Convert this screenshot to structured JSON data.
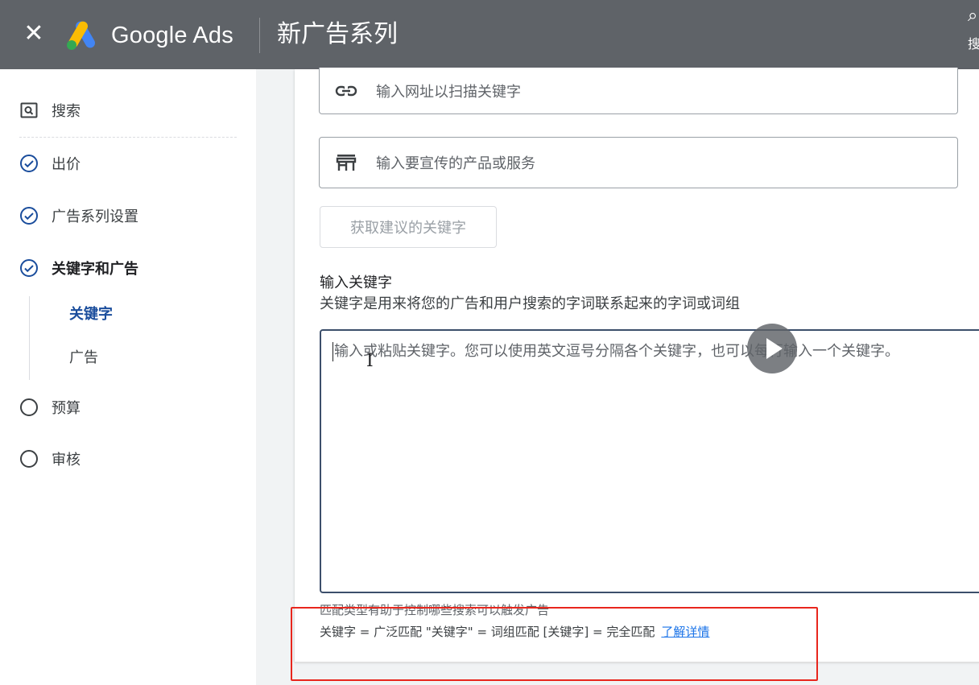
{
  "header": {
    "close_icon": "close-icon",
    "brand": "Google Ads",
    "title": "新广告系列",
    "right_icon": "search-icon",
    "right_text": "搜"
  },
  "sidebar": {
    "items": [
      {
        "label": "搜索",
        "icon": "search-box-icon"
      },
      {
        "label": "出价",
        "icon": "check-circle-icon"
      },
      {
        "label": "广告系列设置",
        "icon": "check-circle-icon"
      },
      {
        "label": "关键字和广告",
        "icon": "check-circle-icon"
      },
      {
        "label": "预算",
        "icon": "empty-circle-icon"
      },
      {
        "label": "审核",
        "icon": "empty-circle-icon"
      }
    ],
    "subitems": [
      {
        "label": "关键字",
        "active": true
      },
      {
        "label": "广告",
        "active": false
      }
    ]
  },
  "main": {
    "url_input": {
      "placeholder": "输入网址以扫描关键字",
      "icon": "link-icon"
    },
    "product_input": {
      "placeholder": "输入要宣传的产品或服务",
      "icon": "store-icon"
    },
    "suggest_button": "获取建议的关键字",
    "keywords_title": "输入关键字",
    "keywords_desc": "关键字是用来将您的广告和用户搜索的字词联系起来的字词或词组",
    "keywords_placeholder": "输入或粘贴关键字。您可以使用英文逗号分隔各个关键字，也可以每行输入一个关键字。",
    "match_note": "匹配类型有助于控制哪些搜索可以触发广告",
    "match_legend": "关键字 = 广泛匹配  \"关键字\" = 词组匹配  [关键字] = 完全匹配",
    "learn_more": "了解详情"
  },
  "colors": {
    "topbar": "#5f6368",
    "active_nav": "#1a4d9c",
    "link": "#1a73e8",
    "highlight": "#e8261d"
  }
}
